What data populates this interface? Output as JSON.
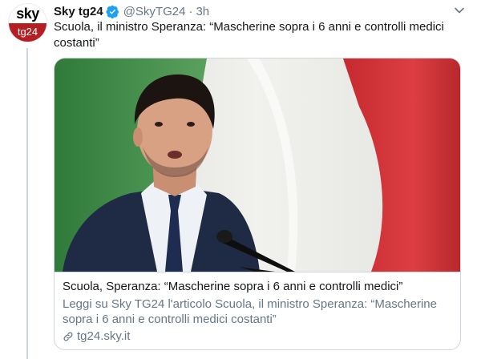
{
  "author": {
    "avatar_top": "sky",
    "avatar_bottom": "tg24",
    "name": "Sky tg24",
    "handle": "@SkyTG24",
    "separator": "·",
    "time": "3h"
  },
  "tweet": {
    "text": "Scuola, il ministro Speranza: “Mascherine sopra i 6 anni e controlli medici costanti”"
  },
  "card": {
    "title": "Scuola, Speranza: “Mascherine sopra i 6 anni e controlli medici”",
    "description": "Leggi su Sky TG24 l'articolo Scuola, il ministro Speranza: “Mascherine sopra i 6 anni e controlli medici costanti”",
    "domain": "tg24.sky.it"
  },
  "icons": {
    "verified": "verified-badge-icon",
    "more": "chevron-down-icon",
    "link": "link-icon"
  },
  "colors": {
    "verified_blue": "#1da1f2",
    "brand_red": "#b51f24",
    "flag_green": "#3f8a49",
    "flag_red": "#d1343a",
    "secondary_text": "#657786"
  }
}
